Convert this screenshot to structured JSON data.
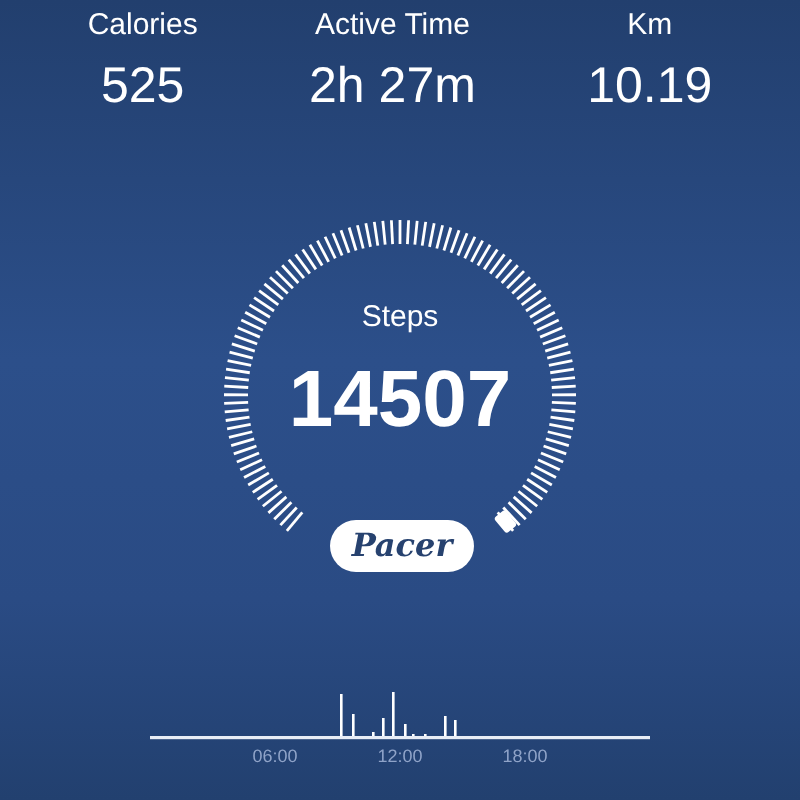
{
  "stats": [
    {
      "label": "Calories",
      "value": "525"
    },
    {
      "label": "Active Time",
      "value": "2h 27m"
    },
    {
      "label": "Km",
      "value": "10.19"
    }
  ],
  "gauge": {
    "label": "Steps",
    "value": "14507"
  },
  "logo_button": {
    "label": "Pacer"
  },
  "activity": {
    "time_labels": [
      "06:00",
      "12:00",
      "18:00"
    ]
  }
}
